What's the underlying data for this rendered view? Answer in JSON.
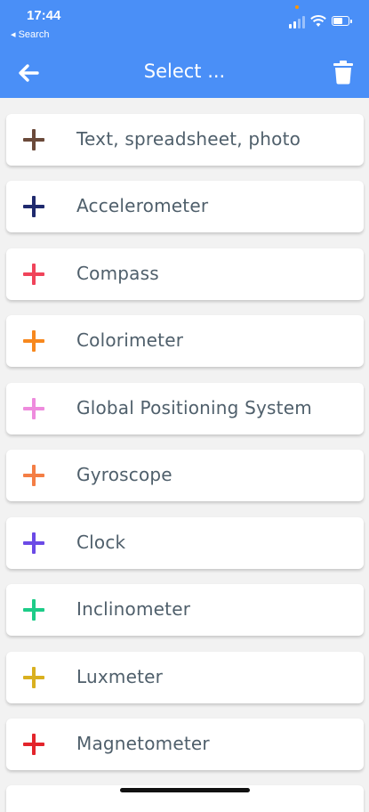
{
  "status_bar": {
    "time": "17:44",
    "back_label": "◂ Search"
  },
  "header": {
    "title": "Select ...",
    "background": "#4a8ff7"
  },
  "items": [
    {
      "label": "Text, spreadsheet, photo",
      "color": "#6b4a3a",
      "icon": "plus-icon"
    },
    {
      "label": "Accelerometer",
      "color": "#1f2a6e",
      "icon": "plus-icon"
    },
    {
      "label": "Compass",
      "color": "#f0435a",
      "icon": "plus-icon"
    },
    {
      "label": "Colorimeter",
      "color": "#f7881e",
      "icon": "plus-icon"
    },
    {
      "label": "Global Positioning System",
      "color": "#ee8bdd",
      "icon": "plus-icon"
    },
    {
      "label": "Gyroscope",
      "color": "#f47e45",
      "icon": "plus-icon"
    },
    {
      "label": "Clock",
      "color": "#6b4ae6",
      "icon": "plus-icon"
    },
    {
      "label": "Inclinometer",
      "color": "#1dcc88",
      "icon": "plus-icon"
    },
    {
      "label": "Luxmeter",
      "color": "#d9b01f",
      "icon": "plus-icon"
    },
    {
      "label": "Magnetometer",
      "color": "#e3242b",
      "icon": "plus-icon"
    },
    {
      "label": "",
      "color": "#ffffff",
      "icon": ""
    }
  ]
}
